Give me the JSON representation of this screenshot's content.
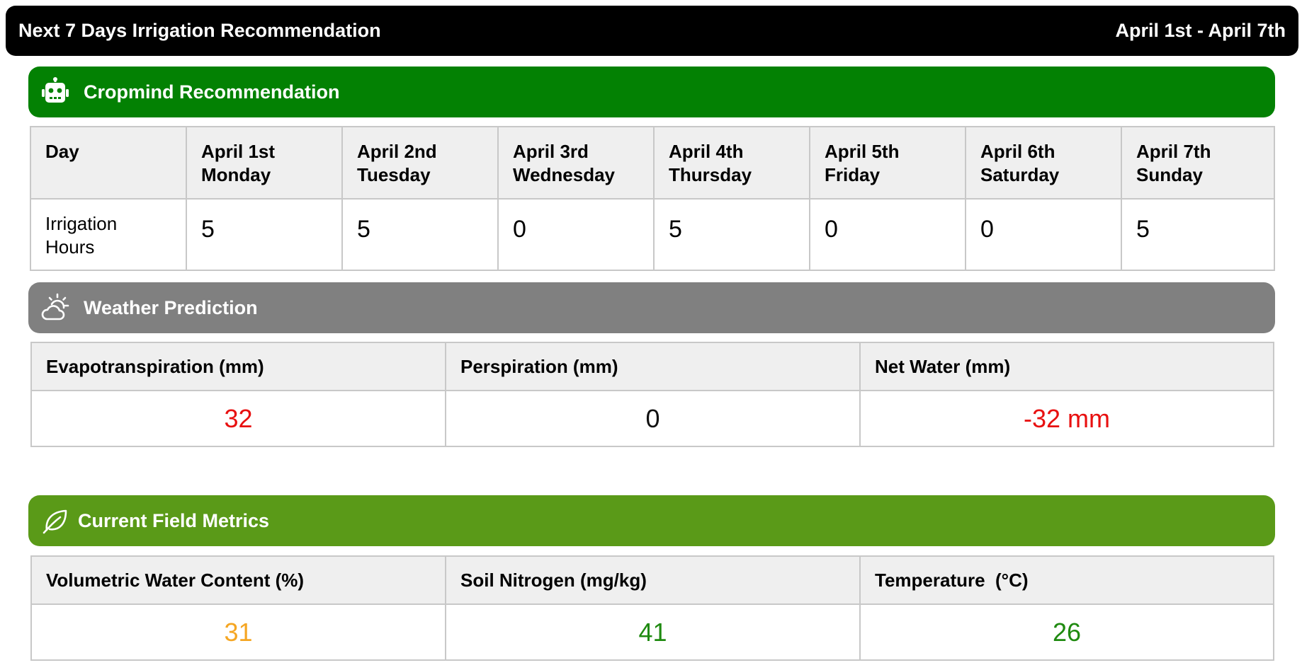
{
  "header": {
    "title": "Next 7 Days Irrigation Recommendation",
    "date_range": "April 1st - April 7th"
  },
  "recommendation": {
    "title": "Cropmind Recommendation",
    "icon": "robot-icon",
    "color": "#038103",
    "row_header": "Day",
    "row_label_line1": "Irrigation",
    "row_label_line2": "Hours",
    "days": [
      {
        "date": "April 1st",
        "weekday": "Monday",
        "hours": "5"
      },
      {
        "date": "April 2nd",
        "weekday": "Tuesday",
        "hours": "5"
      },
      {
        "date": "April 3rd",
        "weekday": "Wednesday",
        "hours": "0"
      },
      {
        "date": "April 4th",
        "weekday": "Thursday",
        "hours": "5"
      },
      {
        "date": "April 5th",
        "weekday": "Friday",
        "hours": "0"
      },
      {
        "date": "April 6th",
        "weekday": "Saturday",
        "hours": "0"
      },
      {
        "date": "April 7th",
        "weekday": "Sunday",
        "hours": "5"
      }
    ]
  },
  "weather": {
    "title": "Weather Prediction",
    "icon": "partly-cloudy-icon",
    "color": "#808080",
    "columns": [
      {
        "label": "Evapotranspiration (mm)",
        "value": "32",
        "color": "#e81010"
      },
      {
        "label": "Perspiration (mm)",
        "value": "0",
        "color": "#111111"
      },
      {
        "label": "Net Water (mm)",
        "value": "-32 mm",
        "color": "#e81010"
      }
    ]
  },
  "field": {
    "title": "Current Field Metrics",
    "icon": "leaf-icon",
    "color": "#5a9a18",
    "columns": [
      {
        "label": "Volumetric Water Content (%)",
        "value": "31",
        "color": "#f5a623"
      },
      {
        "label": "Soil Nitrogen (mg/kg)",
        "value": "41",
        "color": "#1f8a10"
      },
      {
        "label": "Temperature  (°C)",
        "value": "26",
        "color": "#1f8a10"
      }
    ]
  }
}
